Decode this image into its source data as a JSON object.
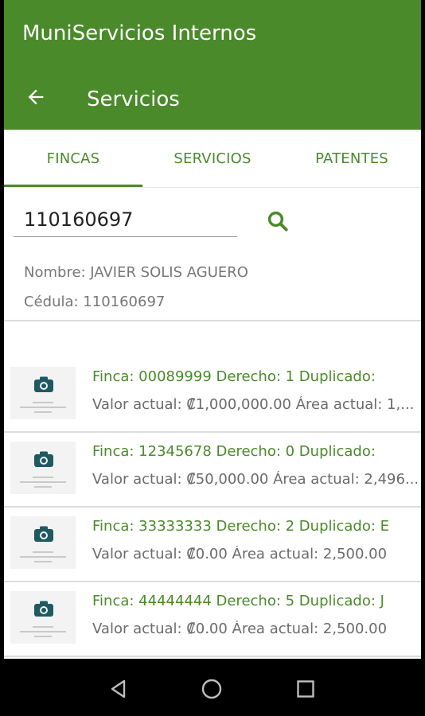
{
  "app": {
    "title": "MuniServicios Internos"
  },
  "toolbar": {
    "title": "Servicios",
    "back_icon": "arrow-back-icon"
  },
  "tabs": [
    {
      "label": "FINCAS",
      "selected": true
    },
    {
      "label": "SERVICIOS",
      "selected": false
    },
    {
      "label": "PATENTES",
      "selected": false
    }
  ],
  "search": {
    "value": "110160697",
    "icon": "search-icon"
  },
  "owner": {
    "name_label": "Nombre: JAVIER SOLIS AGUERO",
    "id_label": "Cédula: 110160697"
  },
  "fincas": [
    {
      "title": "Finca: 00089999 Derecho: 1 Duplicado:",
      "subtitle": "Valor actual: ₡1,000,000.00 Área actual: 1,..."
    },
    {
      "title": "Finca: 12345678 Derecho: 0 Duplicado:",
      "subtitle": "Valor actual: ₡50,000.00 Área actual: 2,496..."
    },
    {
      "title": "Finca: 33333333 Derecho: 2 Duplicado: E",
      "subtitle": "Valor actual: ₡0.00 Área actual: 2,500.00"
    },
    {
      "title": "Finca: 44444444 Derecho: 5 Duplicado: J",
      "subtitle": "Valor actual: ₡0.00 Área actual: 2,500.00"
    }
  ],
  "colors": {
    "primary": "#4a8a2a",
    "text_secondary": "#777777",
    "divider": "#dcdcdc"
  },
  "navbar": {
    "icons": [
      "back-triangle-icon",
      "home-circle-icon",
      "recents-square-icon"
    ]
  }
}
